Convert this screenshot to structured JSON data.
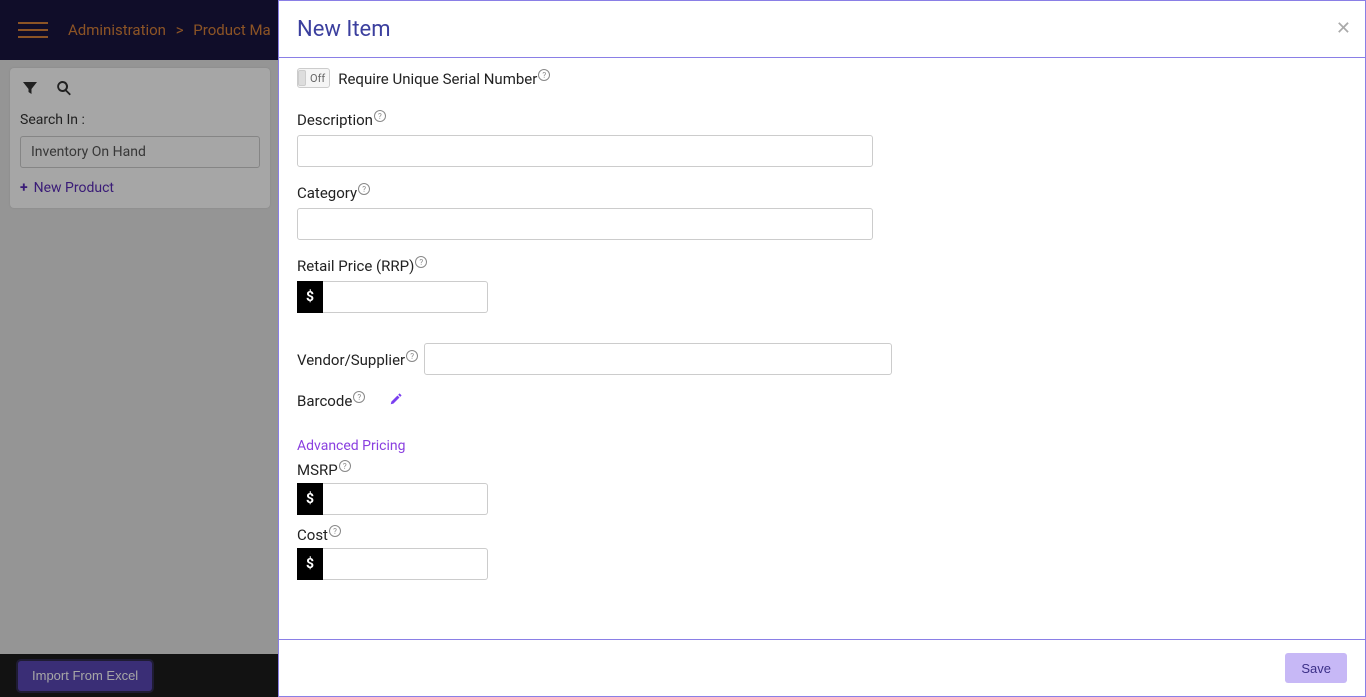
{
  "header": {
    "breadcrumb_admin": "Administration",
    "breadcrumb_sep": ">",
    "breadcrumb_product": "Product Ma"
  },
  "sidebarCard": {
    "search_label": "Search In :",
    "search_value": "Inventory On Hand",
    "new_product_label": "New Product"
  },
  "footer": {
    "import_label": "Import From Excel"
  },
  "modal": {
    "title": "New Item",
    "save_label": "Save",
    "toggle_off": "Off",
    "require_serial_label": "Require Unique Serial Number",
    "description_label": "Description",
    "category_label": "Category",
    "retail_label": "Retail Price (RRP)",
    "currency": "$",
    "vendor_label": "Vendor/Supplier",
    "barcode_label": "Barcode",
    "adv_pricing_label": "Advanced Pricing",
    "msrp_label": "MSRP",
    "cost_label": "Cost"
  }
}
